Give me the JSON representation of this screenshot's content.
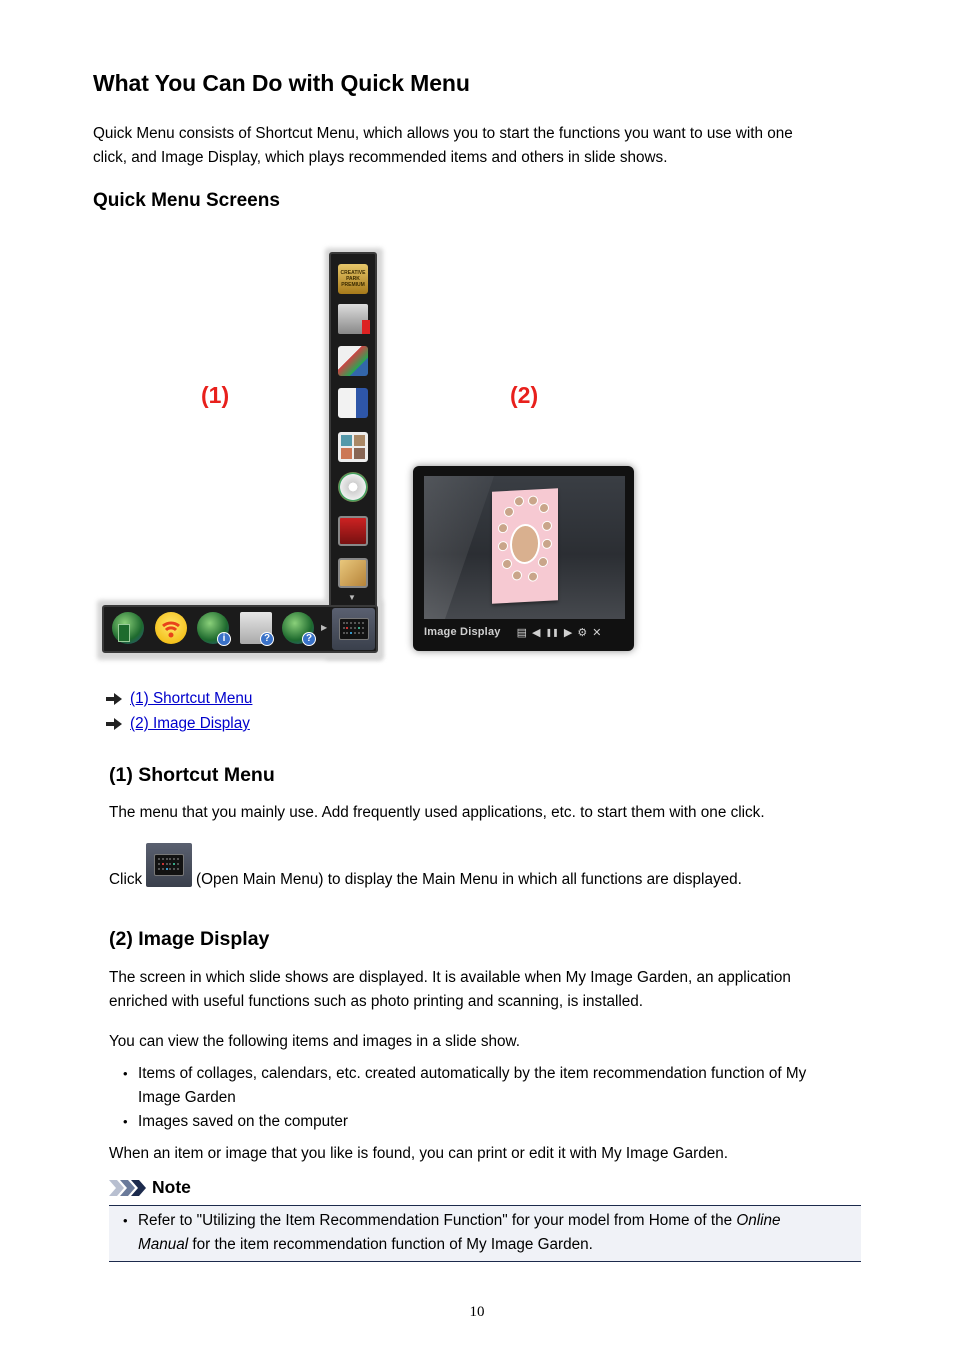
{
  "page": {
    "title": "What You Can Do with Quick Menu",
    "intro_line1": "Quick Menu consists of Shortcut Menu, which allows you to start the functions you want to use with one",
    "intro_line2": "click, and Image Display, which plays recommended items and others in slide shows.",
    "subheading": "Quick Menu Screens",
    "page_number": "10"
  },
  "figure": {
    "label_1": "(1)",
    "label_2": "(2)",
    "shortcut_menu": {
      "vertical_icons": [
        "creative-park-premium-icon",
        "scanner-tools-icon",
        "photo-print-icon",
        "layout-print-icon",
        "collage-icon",
        "disc-label-icon",
        "red-app-icon",
        "photo-edit-icon"
      ],
      "creative_park_text": "CREATIVE PARK PREMIUM",
      "scroll_down": "▼",
      "horizontal_icons": [
        "network-setup-icon",
        "wireless-icon",
        "ink-info-icon",
        "help-icon",
        "online-manual-icon"
      ],
      "scroll_right": "▶",
      "open_main_menu": "open-main-menu-icon"
    },
    "image_display": {
      "title": "Image Display",
      "controls": [
        "▤",
        "◀",
        "❚❚",
        "▶",
        "⚙",
        "✕"
      ]
    }
  },
  "links": [
    {
      "label": "(1) Shortcut Menu"
    },
    {
      "label": "(2) Image Display"
    }
  ],
  "section1": {
    "heading": "(1) Shortcut Menu",
    "text": "The menu that you mainly use. Add frequently used applications, etc. to start them with one click.",
    "click_prefix": "Click",
    "click_suffix": "(Open Main Menu) to display the Main Menu in which all functions are displayed."
  },
  "section2": {
    "heading": "(2) Image Display",
    "text_line1": "The screen in which slide shows are displayed. It is available when My Image Garden, an application",
    "text_line2": "enriched with useful functions such as photo printing and scanning, is installed.",
    "list_intro": "You can view the following items and images in a slide show.",
    "bullets": [
      {
        "line1": "Items of collages, calendars, etc. created automatically by the item recommendation function of My",
        "line2": "Image Garden"
      },
      {
        "line1": "Images saved on the computer"
      }
    ],
    "closing": "When an item or image that you like is found, you can print or edit it with My Image Garden."
  },
  "note": {
    "heading": "Note",
    "line1_pre": "Refer to \"Utilizing the Item Recommendation Function\" for your model from Home of the ",
    "line1_italic": "Online",
    "line2_italic": "Manual",
    "line2_post": " for the item recommendation function of My Image Garden."
  },
  "colors": {
    "link": "#0000cc",
    "label_red": "#e8201c",
    "note_border": "#1c2a4c",
    "note_bg": "#f0f2f7"
  }
}
